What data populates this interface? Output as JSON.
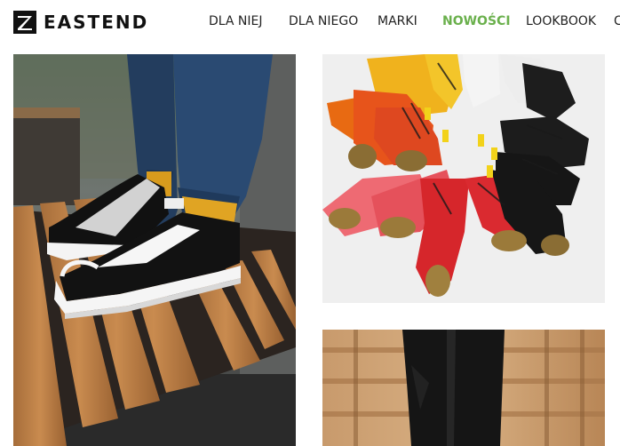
{
  "brand": {
    "name": "EASTEND"
  },
  "nav": {
    "items": [
      {
        "label": "DLA NIEJ"
      },
      {
        "label": "DLA NIEGO"
      },
      {
        "label": "MARKI"
      },
      {
        "label": "NOWOŚCI",
        "active": true
      },
      {
        "label": "LOOKBOOK"
      },
      {
        "label": "C"
      }
    ]
  },
  "colors": {
    "accent": "#6ab04c",
    "text": "#222222"
  },
  "tiles": [
    {
      "subject": "sneakers-on-bench-photo"
    },
    {
      "subject": "boots-circle-photo"
    },
    {
      "subject": "jeans-legs-photo"
    }
  ]
}
